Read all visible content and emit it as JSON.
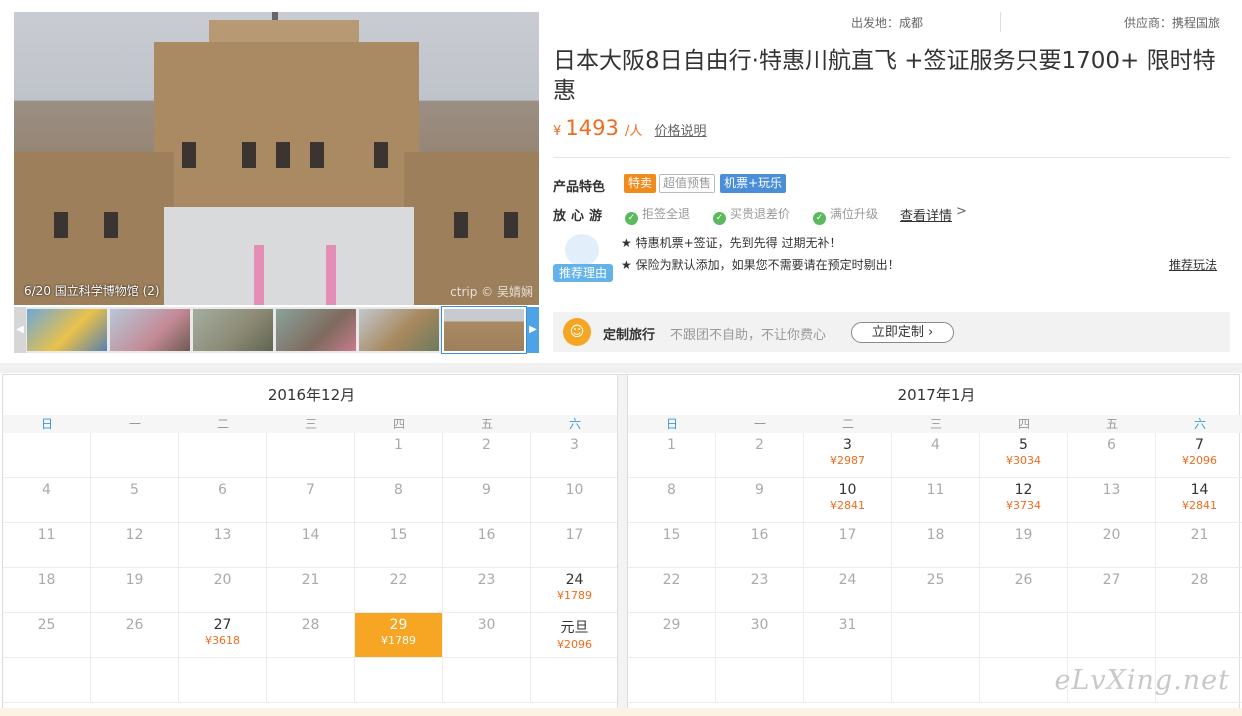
{
  "gallery": {
    "caption": "6/20 国立科学博物馆 (2)",
    "watermark": "ctrip © 吴婧娴",
    "thumb_count": 6,
    "active_thumb": 6
  },
  "product": {
    "origin": "出发地：成都",
    "supplier": "供应商：携程国旅",
    "title": "日本大阪8日自由行·特惠川航直飞 +签证服务只要1700+ 限时特惠",
    "currency": "¥",
    "price": "1493",
    "per": "/人",
    "price_link": "价格说明",
    "features_label": "产品特色",
    "tags": [
      "特卖",
      "超值预售",
      "机票+玩乐"
    ],
    "assure_label": "放心游",
    "assurances": [
      "拒签全退",
      "买贵退差价",
      "满位升级"
    ],
    "detail_link": "查看详情",
    "detail_arrow": ">",
    "rec_badge": "推荐理由",
    "rec_lines": [
      "★ 特惠机票+签证，先到先得 过期无补！",
      "★ 保险为默认添加，如果您不需要请在预定时剔出！"
    ],
    "rec_link": "推荐玩法",
    "custom_title": "定制旅行",
    "custom_desc": "不跟团不自助，不让你费心",
    "custom_btn": "立即定制 ›"
  },
  "calendar": {
    "weekdays": [
      "日",
      "一",
      "二",
      "三",
      "四",
      "五",
      "六"
    ],
    "months": [
      {
        "title": "2016年12月",
        "rows": [
          [
            {
              "d": ""
            },
            {
              "d": ""
            },
            {
              "d": ""
            },
            {
              "d": ""
            },
            {
              "d": "1"
            },
            {
              "d": "2"
            },
            {
              "d": "3"
            }
          ],
          [
            {
              "d": "4"
            },
            {
              "d": "5"
            },
            {
              "d": "6"
            },
            {
              "d": "7"
            },
            {
              "d": "8"
            },
            {
              "d": "9"
            },
            {
              "d": "10"
            }
          ],
          [
            {
              "d": "11"
            },
            {
              "d": "12"
            },
            {
              "d": "13"
            },
            {
              "d": "14"
            },
            {
              "d": "15"
            },
            {
              "d": "16"
            },
            {
              "d": "17"
            }
          ],
          [
            {
              "d": "18"
            },
            {
              "d": "19"
            },
            {
              "d": "20"
            },
            {
              "d": "21"
            },
            {
              "d": "22"
            },
            {
              "d": "23"
            },
            {
              "d": "24",
              "p": "¥1789"
            }
          ],
          [
            {
              "d": "25"
            },
            {
              "d": "26"
            },
            {
              "d": "27",
              "p": "¥3618"
            },
            {
              "d": "28"
            },
            {
              "d": "29",
              "p": "¥1789",
              "sel": true
            },
            {
              "d": "30"
            },
            {
              "d": "元旦",
              "p": "¥2096"
            }
          ],
          [
            {
              "d": ""
            },
            {
              "d": ""
            },
            {
              "d": ""
            },
            {
              "d": ""
            },
            {
              "d": ""
            },
            {
              "d": ""
            },
            {
              "d": ""
            }
          ]
        ]
      },
      {
        "title": "2017年1月",
        "rows": [
          [
            {
              "d": "1"
            },
            {
              "d": "2"
            },
            {
              "d": "3",
              "p": "¥2987"
            },
            {
              "d": "4"
            },
            {
              "d": "5",
              "p": "¥3034"
            },
            {
              "d": "6"
            },
            {
              "d": "7",
              "p": "¥2096"
            }
          ],
          [
            {
              "d": "8"
            },
            {
              "d": "9"
            },
            {
              "d": "10",
              "p": "¥2841"
            },
            {
              "d": "11"
            },
            {
              "d": "12",
              "p": "¥3734"
            },
            {
              "d": "13"
            },
            {
              "d": "14",
              "p": "¥2841"
            }
          ],
          [
            {
              "d": "15"
            },
            {
              "d": "16"
            },
            {
              "d": "17"
            },
            {
              "d": "18"
            },
            {
              "d": "19"
            },
            {
              "d": "20"
            },
            {
              "d": "21"
            }
          ],
          [
            {
              "d": "22"
            },
            {
              "d": "23"
            },
            {
              "d": "24"
            },
            {
              "d": "25"
            },
            {
              "d": "26"
            },
            {
              "d": "27"
            },
            {
              "d": "28"
            }
          ],
          [
            {
              "d": "29"
            },
            {
              "d": "30"
            },
            {
              "d": "31"
            },
            {
              "d": ""
            },
            {
              "d": ""
            },
            {
              "d": ""
            },
            {
              "d": ""
            }
          ],
          [
            {
              "d": ""
            },
            {
              "d": ""
            },
            {
              "d": ""
            },
            {
              "d": ""
            },
            {
              "d": ""
            },
            {
              "d": ""
            },
            {
              "d": ""
            }
          ]
        ]
      }
    ]
  },
  "site_watermark": "eLvXing.net",
  "colors": {
    "accent_orange": "#f06b1d",
    "selected_bg": "#f6a623",
    "weekend_blue": "#3a9ad9",
    "tag_blue": "#4a8ed8"
  }
}
